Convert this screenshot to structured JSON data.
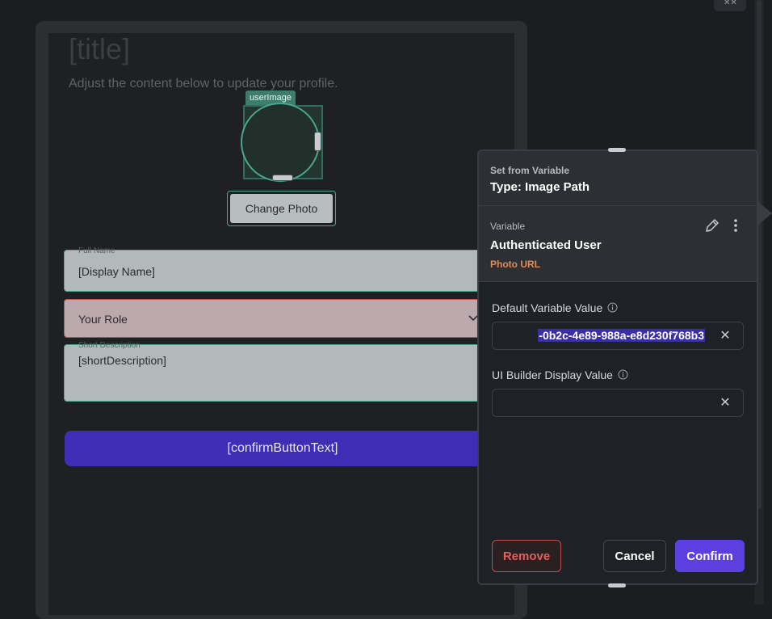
{
  "canvas": {
    "title": "[title]",
    "subtitle": "Adjust the content below to update your profile.",
    "image_tag": "userImage",
    "change_photo_label": "Change Photo",
    "full_name": {
      "label": "Full Name",
      "value": "[Display Name]"
    },
    "role": {
      "value": "Your Role"
    },
    "short_description": {
      "label": "Short Description",
      "value": "[shortDescription]"
    },
    "confirm_button": "[confirmButtonText]"
  },
  "panel": {
    "header": {
      "kicker": "Set from Variable",
      "type": "Type: Image Path"
    },
    "variable": {
      "label": "Variable",
      "name": "Authenticated User",
      "property": "Photo URL"
    },
    "default_value": {
      "label": "Default Variable Value",
      "value": "-0b2c-4e89-988a-e8d230f768b3"
    },
    "ui_builder_value": {
      "label": "UI Builder Display Value",
      "value": ""
    },
    "buttons": {
      "remove": "Remove",
      "cancel": "Cancel",
      "confirm": "Confirm"
    }
  },
  "icons": [
    "edit-pencil-icon",
    "more-vertical-icon",
    "info-icon",
    "clear-x-icon",
    "chevron-down-icon"
  ],
  "colors": {
    "accent": "#5b3fe0",
    "danger": "#e0605c",
    "selection": "#4aa68c",
    "property": "#e58a55"
  }
}
